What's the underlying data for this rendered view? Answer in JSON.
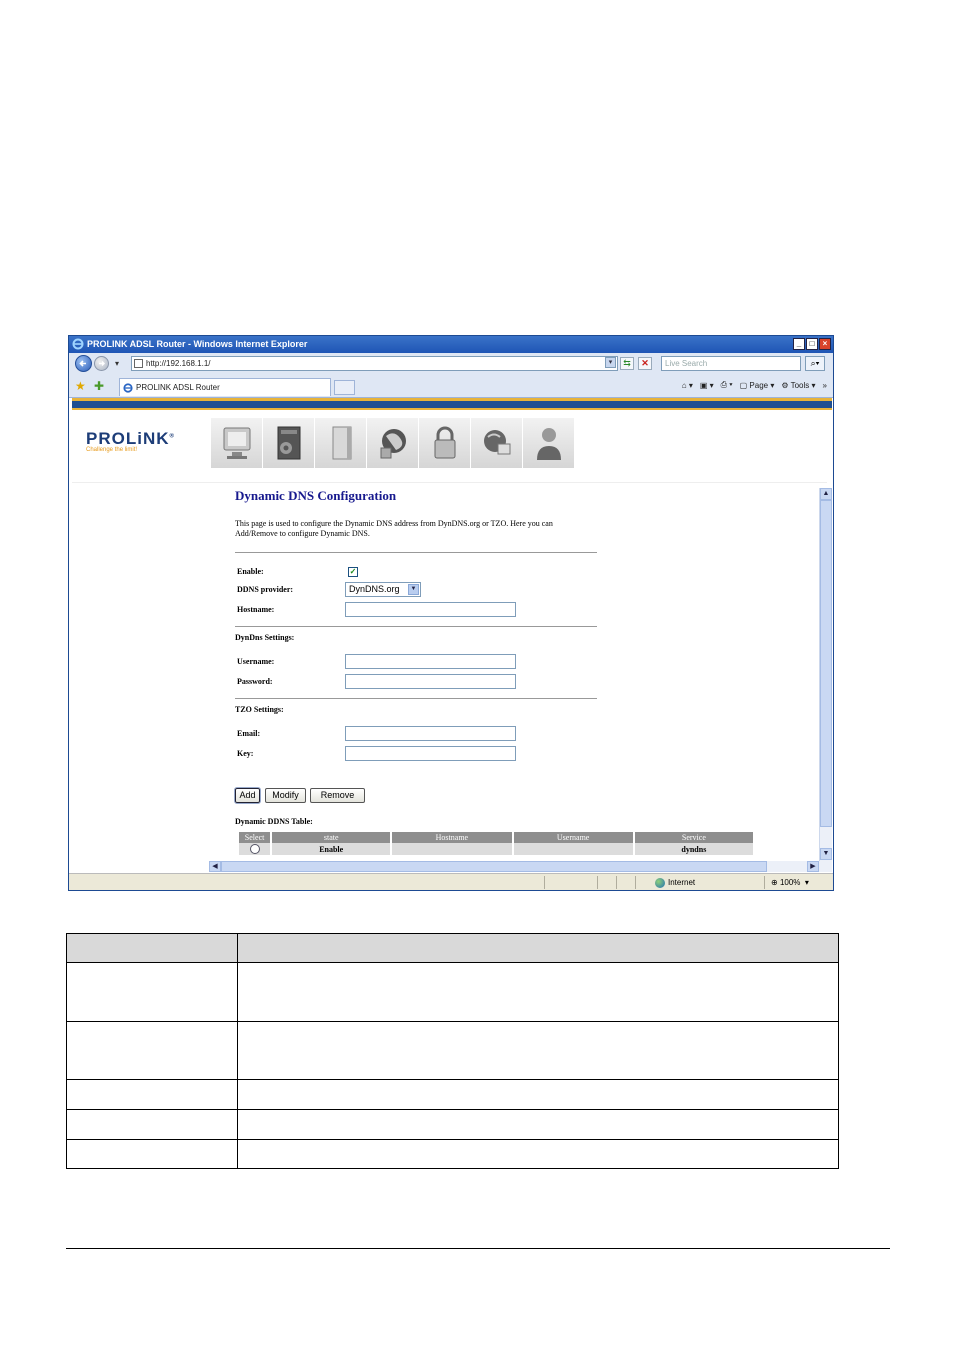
{
  "window": {
    "title": "PROLINK ADSL Router - Windows Internet Explorer",
    "url": "http://192.168.1.1/",
    "search_placeholder": "Live Search",
    "tab_title": "PROLINK ADSL Router",
    "cmd": {
      "page": "Page",
      "tools": "Tools",
      "more": "»"
    }
  },
  "banner": {
    "brand": "PROLiNK",
    "tagline": "Challenge the limit!",
    "nav_icons": [
      "status-icon",
      "setup-icon",
      "device-icon",
      "network-icon",
      "security-icon",
      "diagnostic-icon",
      "admin-icon"
    ]
  },
  "page": {
    "heading": "Dynamic DNS Configuration",
    "description": "This page is used to configure the Dynamic DNS address from DynDNS.org or TZO. Here you can Add/Remove to configure Dynamic DNS.",
    "enable_label": "Enable:",
    "enable_checked": true,
    "provider_label": "DDNS provider:",
    "provider_value": "DynDNS.org",
    "hostname_label": "Hostname:",
    "dyndns_section": "DynDns Settings:",
    "username_label": "Username:",
    "password_label": "Password:",
    "tzo_section": "TZO Settings:",
    "email_label": "Email:",
    "key_label": "Key:",
    "buttons": {
      "add": "Add",
      "modify": "Modify",
      "remove": "Remove"
    },
    "table_title": "Dynamic DDNS Table:",
    "table": {
      "headers": [
        "Select",
        "state",
        "Hostname",
        "Username",
        "Service"
      ],
      "rows": [
        {
          "state": "Enable",
          "hostname": "",
          "username": "",
          "service": "dyndns"
        }
      ]
    }
  },
  "statusbar": {
    "zone": "Internet",
    "zoom": "100%"
  }
}
